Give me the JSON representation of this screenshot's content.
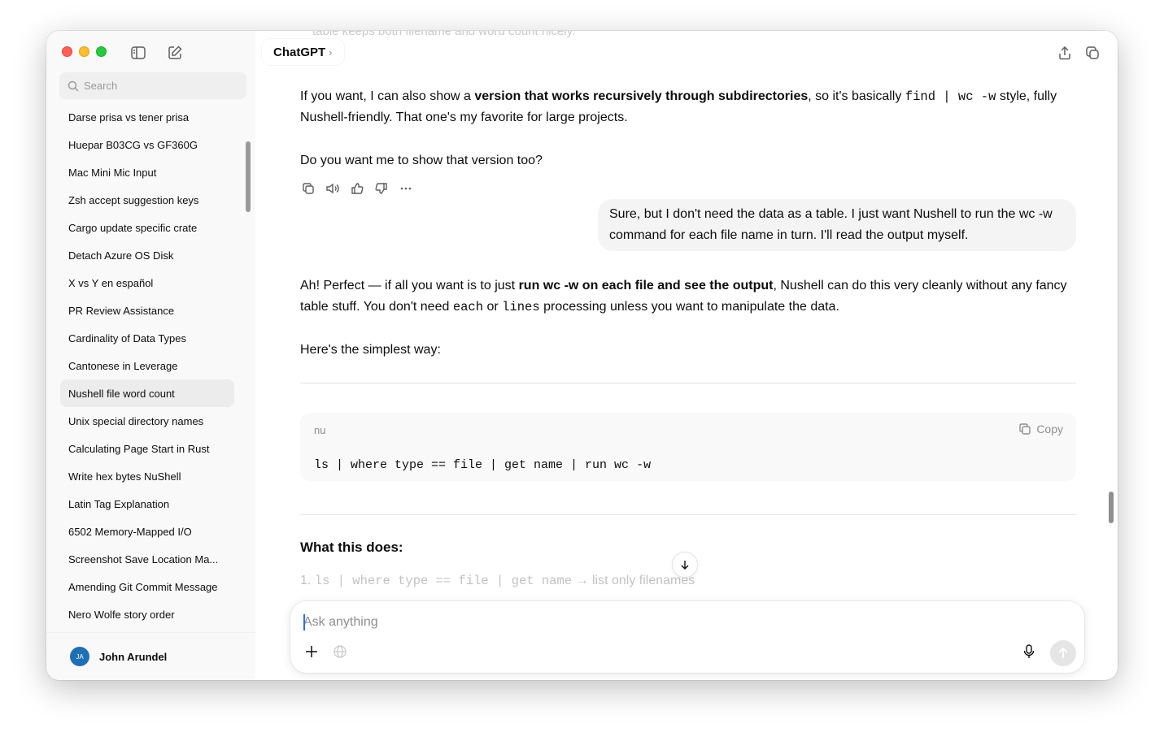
{
  "sidebar": {
    "search_placeholder": "Search",
    "items": [
      {
        "label": "Darse prisa vs tener prisa"
      },
      {
        "label": "Huepar B03CG vs GF360G"
      },
      {
        "label": "Mac Mini Mic Input"
      },
      {
        "label": "Zsh accept suggestion keys"
      },
      {
        "label": "Cargo update specific crate"
      },
      {
        "label": "Detach Azure OS Disk"
      },
      {
        "label": "X vs Y en español"
      },
      {
        "label": "PR Review Assistance"
      },
      {
        "label": "Cardinality of Data Types"
      },
      {
        "label": "Cantonese in Leverage"
      },
      {
        "label": "Nushell file word count"
      },
      {
        "label": "Unix special directory names"
      },
      {
        "label": "Calculating Page Start in Rust"
      },
      {
        "label": "Write hex bytes NuShell"
      },
      {
        "label": "Latin Tag Explanation"
      },
      {
        "label": "6502 Memory-Mapped I/O"
      },
      {
        "label": "Screenshot Save Location Ma..."
      },
      {
        "label": "Amending Git Commit Message"
      },
      {
        "label": "Nero Wolfe story order"
      }
    ],
    "active_item": "Nushell file word count",
    "user": {
      "initials": "JA",
      "name": "John Arundel"
    }
  },
  "header": {
    "model": "ChatGPT",
    "model_chevron": "›",
    "ghost_text": "table keeps both filename and word count nicely."
  },
  "messages": {
    "assistant1": {
      "p1_a": "If you want, I can also show a ",
      "p1_bold": "version that works recursively through subdirectories",
      "p1_b": ", so it's basically ",
      "p1_code": "find | wc -w",
      "p1_c": " style, fully Nushell-friendly. That one's my favorite for large projects.",
      "p2": "Do you want me to show that version too?"
    },
    "user1": "Sure, but I don't need the data as a table. I just want Nushell to run the wc -w command for each file name in turn. I'll read the output myself.",
    "assistant2": {
      "p1_a": "Ah! Perfect — if all you want is to just ",
      "p1_bold": "run wc -w on each file and see the output",
      "p1_b": ", Nushell can do this very cleanly without any fancy table stuff. You don't need ",
      "p1_code1": "each",
      "p1_c": " or ",
      "p1_code2": "lines",
      "p1_d": " processing unless you want to manipulate the data.",
      "p2": "Here's the simplest way:",
      "code_lang": "nu",
      "copy_label": "Copy",
      "code": "ls | where type == file | get name | run wc -w",
      "heading": "What this does:",
      "item1_num": "1.",
      "item1_code": "ls | where type == file | get name",
      "item1_text": "→ list only filenames"
    }
  },
  "composer": {
    "placeholder": "Ask anything"
  }
}
